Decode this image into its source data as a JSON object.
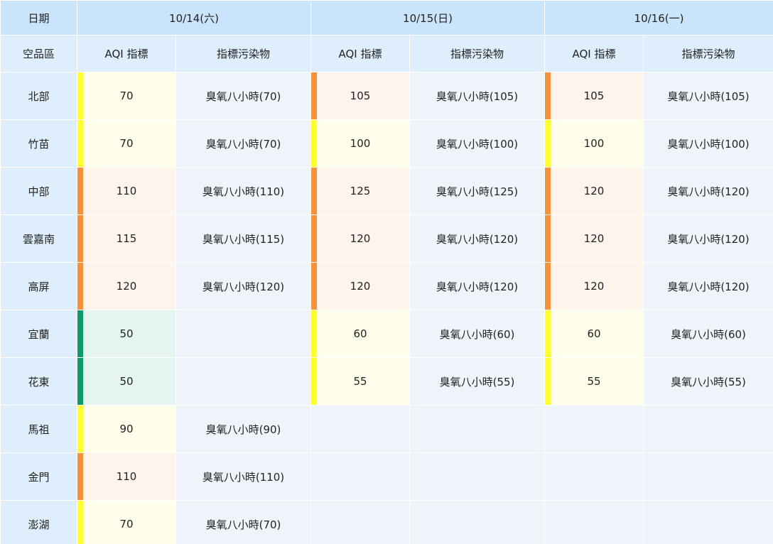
{
  "header": {
    "date_label": "日期",
    "region_label": "空品區",
    "aqi_label": "AQI 指標",
    "pollutant_label": "指標污染物",
    "days": [
      "10/14(六)",
      "10/15(日)",
      "10/16(一)"
    ]
  },
  "levels": {
    "good": {
      "bar": "#0b9a6c",
      "bg": "#e4f4ee"
    },
    "moderate": {
      "bar": "#ffff2b",
      "bg": "#fffeea"
    },
    "sensitive": {
      "bar": "#f7923a",
      "bg": "#fef4ec"
    }
  },
  "rows": [
    {
      "region": "北部",
      "days": [
        {
          "aqi": "70",
          "level": "moderate",
          "pollutant": "臭氧八小時(70)"
        },
        {
          "aqi": "105",
          "level": "sensitive",
          "pollutant": "臭氧八小時(105)"
        },
        {
          "aqi": "105",
          "level": "sensitive",
          "pollutant": "臭氧八小時(105)"
        }
      ]
    },
    {
      "region": "竹苗",
      "days": [
        {
          "aqi": "70",
          "level": "moderate",
          "pollutant": "臭氧八小時(70)"
        },
        {
          "aqi": "100",
          "level": "moderate",
          "pollutant": "臭氧八小時(100)"
        },
        {
          "aqi": "100",
          "level": "moderate",
          "pollutant": "臭氧八小時(100)"
        }
      ]
    },
    {
      "region": "中部",
      "days": [
        {
          "aqi": "110",
          "level": "sensitive",
          "pollutant": "臭氧八小時(110)"
        },
        {
          "aqi": "125",
          "level": "sensitive",
          "pollutant": "臭氧八小時(125)"
        },
        {
          "aqi": "120",
          "level": "sensitive",
          "pollutant": "臭氧八小時(120)"
        }
      ]
    },
    {
      "region": "雲嘉南",
      "days": [
        {
          "aqi": "115",
          "level": "sensitive",
          "pollutant": "臭氧八小時(115)"
        },
        {
          "aqi": "120",
          "level": "sensitive",
          "pollutant": "臭氧八小時(120)"
        },
        {
          "aqi": "120",
          "level": "sensitive",
          "pollutant": "臭氧八小時(120)"
        }
      ]
    },
    {
      "region": "高屏",
      "days": [
        {
          "aqi": "120",
          "level": "sensitive",
          "pollutant": "臭氧八小時(120)"
        },
        {
          "aqi": "120",
          "level": "sensitive",
          "pollutant": "臭氧八小時(120)"
        },
        {
          "aqi": "120",
          "level": "sensitive",
          "pollutant": "臭氧八小時(120)"
        }
      ]
    },
    {
      "region": "宜蘭",
      "days": [
        {
          "aqi": "50",
          "level": "good",
          "pollutant": ""
        },
        {
          "aqi": "60",
          "level": "moderate",
          "pollutant": "臭氧八小時(60)"
        },
        {
          "aqi": "60",
          "level": "moderate",
          "pollutant": "臭氧八小時(60)"
        }
      ]
    },
    {
      "region": "花東",
      "days": [
        {
          "aqi": "50",
          "level": "good",
          "pollutant": ""
        },
        {
          "aqi": "55",
          "level": "moderate",
          "pollutant": "臭氧八小時(55)"
        },
        {
          "aqi": "55",
          "level": "moderate",
          "pollutant": "臭氧八小時(55)"
        }
      ]
    },
    {
      "region": "馬祖",
      "days": [
        {
          "aqi": "90",
          "level": "moderate",
          "pollutant": "臭氧八小時(90)"
        }
      ]
    },
    {
      "region": "金門",
      "days": [
        {
          "aqi": "110",
          "level": "sensitive",
          "pollutant": "臭氧八小時(110)"
        }
      ]
    },
    {
      "region": "澎湖",
      "days": [
        {
          "aqi": "70",
          "level": "moderate",
          "pollutant": "臭氧八小時(70)"
        }
      ]
    }
  ]
}
